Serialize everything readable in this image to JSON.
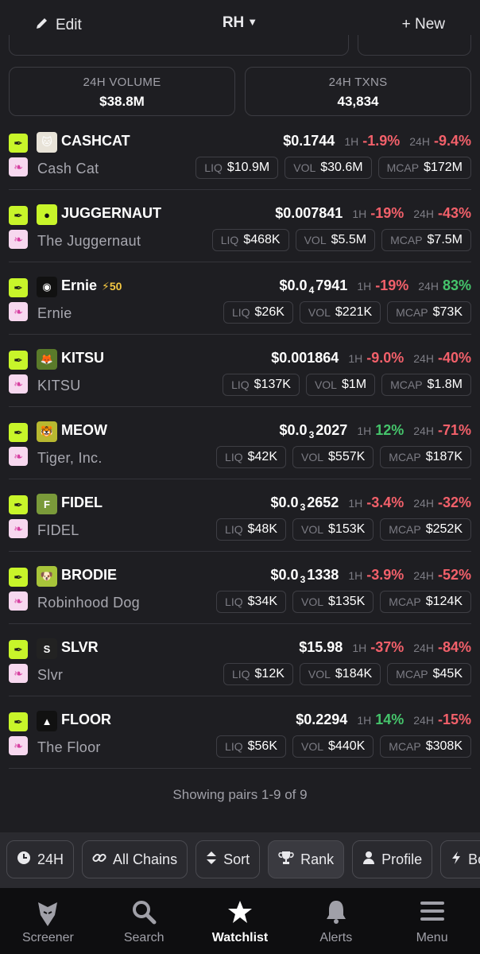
{
  "header": {
    "edit_label": "Edit",
    "network_label": "RH",
    "new_label": "+ New"
  },
  "stats": {
    "volume_label": "24H VOLUME",
    "volume_value": "$38.8M",
    "txns_label": "24H TXNS",
    "txns_value": "43,834"
  },
  "labels": {
    "h1": "1H",
    "h24": "24H",
    "liq": "LIQ",
    "vol": "VOL",
    "mcap": "MCAP"
  },
  "rows": [
    {
      "symbol": "CASHCAT",
      "name": "Cash Cat",
      "price_pre": "$0.1744",
      "price_sub": "",
      "price_post": "",
      "h1": "-1.9%",
      "h1_dir": "neg",
      "h24": "-9.4%",
      "h24_dir": "neg",
      "liq": "$10.9M",
      "vol": "$30.6M",
      "mcap": "$172M",
      "icon": "cat-icon",
      "icon_bg": "#e8e3d8",
      "boost": ""
    },
    {
      "symbol": "JUGGERNAUT",
      "name": "The Juggernaut",
      "price_pre": "$0.007841",
      "price_sub": "",
      "price_post": "",
      "h1": "-19%",
      "h1_dir": "neg",
      "h24": "-43%",
      "h24_dir": "neg",
      "liq": "$468K",
      "vol": "$5.5M",
      "mcap": "$7.5M",
      "icon": "juggernaut-icon",
      "icon_bg": "#c8f52a",
      "boost": ""
    },
    {
      "symbol": "Ernie",
      "name": "Ernie",
      "price_pre": "$0.0",
      "price_sub": "4",
      "price_post": "7941",
      "h1": "-19%",
      "h1_dir": "neg",
      "h24": "83%",
      "h24_dir": "pos",
      "liq": "$26K",
      "vol": "$221K",
      "mcap": "$73K",
      "icon": "ernie-icon",
      "icon_bg": "#111111",
      "boost": "⚡50"
    },
    {
      "symbol": "KITSU",
      "name": "KITSU",
      "price_pre": "$0.001864",
      "price_sub": "",
      "price_post": "",
      "h1": "-9.0%",
      "h1_dir": "neg",
      "h24": "-40%",
      "h24_dir": "neg",
      "liq": "$137K",
      "vol": "$1M",
      "mcap": "$1.8M",
      "icon": "fox-icon",
      "icon_bg": "#5a7a2a",
      "boost": ""
    },
    {
      "symbol": "MEOW",
      "name": "Tiger, Inc.",
      "price_pre": "$0.0",
      "price_sub": "3",
      "price_post": "2027",
      "h1": "12%",
      "h1_dir": "pos",
      "h24": "-71%",
      "h24_dir": "neg",
      "liq": "$42K",
      "vol": "$557K",
      "mcap": "$187K",
      "icon": "tiger-icon",
      "icon_bg": "#b8b830",
      "boost": ""
    },
    {
      "symbol": "FIDEL",
      "name": "FIDEL",
      "price_pre": "$0.0",
      "price_sub": "3",
      "price_post": "2652",
      "h1": "-3.4%",
      "h1_dir": "neg",
      "h24": "-32%",
      "h24_dir": "neg",
      "liq": "$48K",
      "vol": "$153K",
      "mcap": "$252K",
      "icon": "fidel-icon",
      "icon_bg": "#7a9a3a",
      "boost": ""
    },
    {
      "symbol": "BRODIE",
      "name": "Robinhood Dog",
      "price_pre": "$0.0",
      "price_sub": "3",
      "price_post": "1338",
      "h1": "-3.9%",
      "h1_dir": "neg",
      "h24": "-52%",
      "h24_dir": "neg",
      "liq": "$34K",
      "vol": "$135K",
      "mcap": "$124K",
      "icon": "dog-icon",
      "icon_bg": "#a8c43a",
      "boost": ""
    },
    {
      "symbol": "SLVR",
      "name": "Slvr",
      "price_pre": "$15.98",
      "price_sub": "",
      "price_post": "",
      "h1": "-37%",
      "h1_dir": "neg",
      "h24": "-84%",
      "h24_dir": "neg",
      "liq": "$12K",
      "vol": "$184K",
      "mcap": "$45K",
      "icon": "slvr-icon",
      "icon_bg": "#222222",
      "boost": ""
    },
    {
      "symbol": "FLOOR",
      "name": "The Floor",
      "price_pre": "$0.2294",
      "price_sub": "",
      "price_post": "",
      "h1": "14%",
      "h1_dir": "pos",
      "h24": "-15%",
      "h24_dir": "neg",
      "liq": "$56K",
      "vol": "$440K",
      "mcap": "$308K",
      "icon": "floor-icon",
      "icon_bg": "#111111",
      "boost": ""
    }
  ],
  "footer": {
    "showing": "Showing pairs 1-9 of 9"
  },
  "filters": [
    {
      "label": "24H",
      "icon": "clock-icon"
    },
    {
      "label": "All Chains",
      "icon": "link-icon"
    },
    {
      "label": "Sort",
      "icon": "sort-icon"
    },
    {
      "label": "Rank",
      "icon": "trophy-icon"
    },
    {
      "label": "Profile",
      "icon": "user-icon"
    },
    {
      "label": "Boos",
      "icon": "bolt-icon"
    }
  ],
  "tabs": [
    {
      "label": "Screener",
      "icon": "eagle-icon"
    },
    {
      "label": "Search",
      "icon": "search-icon"
    },
    {
      "label": "Watchlist",
      "icon": "star-icon"
    },
    {
      "label": "Alerts",
      "icon": "bell-icon"
    },
    {
      "label": "Menu",
      "icon": "menu-icon"
    }
  ],
  "colors": {
    "accent_lime": "#c8f52a",
    "negative": "#f2606a",
    "positive": "#45c46b",
    "boost": "#f5c842"
  }
}
